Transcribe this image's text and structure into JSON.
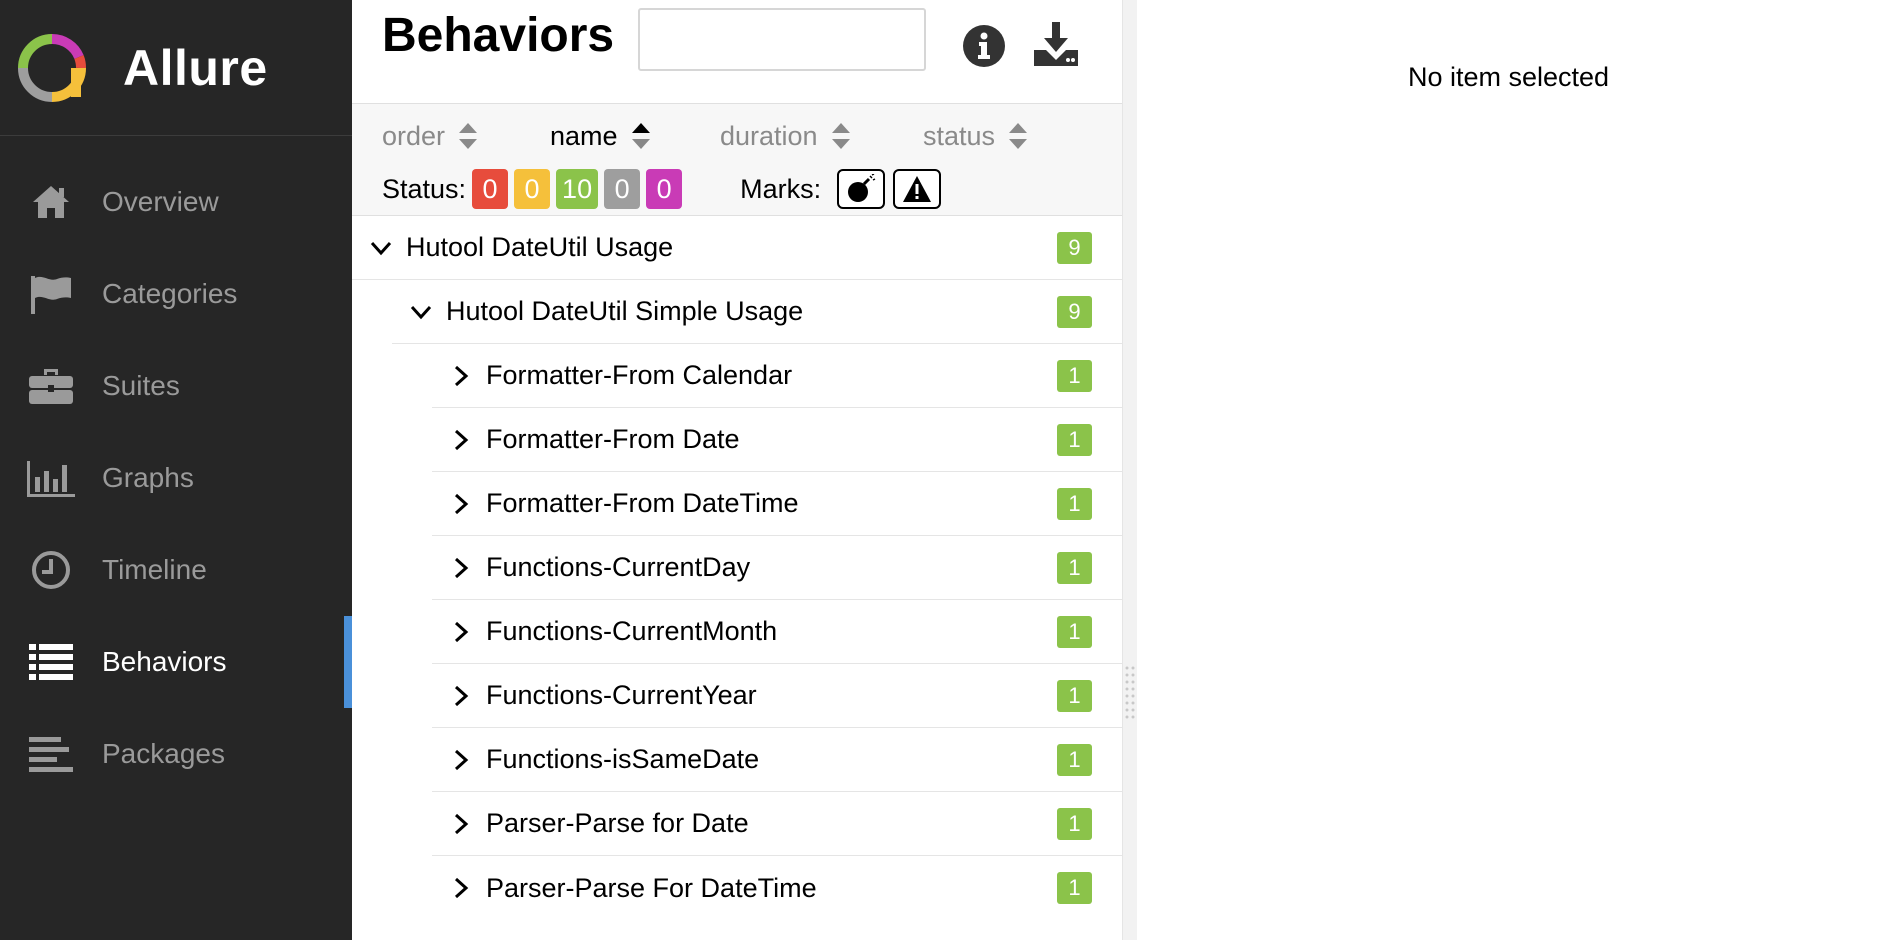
{
  "brand": {
    "name": "Allure"
  },
  "sidebar": {
    "items": [
      {
        "label": "Overview",
        "icon": "home-icon"
      },
      {
        "label": "Categories",
        "icon": "flag-icon"
      },
      {
        "label": "Suites",
        "icon": "briefcase-icon"
      },
      {
        "label": "Graphs",
        "icon": "bar-chart-icon"
      },
      {
        "label": "Timeline",
        "icon": "clock-icon"
      },
      {
        "label": "Behaviors",
        "icon": "list-icon",
        "active": true
      },
      {
        "label": "Packages",
        "icon": "align-left-icon"
      }
    ],
    "accent_color": "#4a90d9"
  },
  "header": {
    "title": "Behaviors",
    "search_value": ""
  },
  "sort": {
    "fields": [
      {
        "label": "order"
      },
      {
        "label": "name",
        "active": true
      },
      {
        "label": "duration"
      },
      {
        "label": "status"
      }
    ]
  },
  "status_filter": {
    "label": "Status:",
    "badges": [
      {
        "status": "failed",
        "count": "0",
        "color": "#e74c3c"
      },
      {
        "status": "broken",
        "count": "0",
        "color": "#f5c03b"
      },
      {
        "status": "passed",
        "count": "10",
        "color": "#8bc34a"
      },
      {
        "status": "skipped",
        "count": "0",
        "color": "#9e9e9e"
      },
      {
        "status": "unknown",
        "count": "0",
        "color": "#c93bb6"
      }
    ]
  },
  "marks": {
    "label": "Marks:",
    "items": [
      {
        "icon": "bomb-icon"
      },
      {
        "icon": "warning-icon"
      }
    ]
  },
  "tree": {
    "rows": [
      {
        "label": "Hutool DateUtil Usage",
        "count": "9",
        "level": 0,
        "expanded": true
      },
      {
        "label": "Hutool DateUtil Simple Usage",
        "count": "9",
        "level": 1,
        "expanded": true
      },
      {
        "label": "Formatter-From Calendar",
        "count": "1",
        "level": 2,
        "expanded": false
      },
      {
        "label": "Formatter-From Date",
        "count": "1",
        "level": 2,
        "expanded": false
      },
      {
        "label": "Formatter-From DateTime",
        "count": "1",
        "level": 2,
        "expanded": false
      },
      {
        "label": "Functions-CurrentDay",
        "count": "1",
        "level": 2,
        "expanded": false
      },
      {
        "label": "Functions-CurrentMonth",
        "count": "1",
        "level": 2,
        "expanded": false
      },
      {
        "label": "Functions-CurrentYear",
        "count": "1",
        "level": 2,
        "expanded": false
      },
      {
        "label": "Functions-isSameDate",
        "count": "1",
        "level": 2,
        "expanded": false
      },
      {
        "label": "Parser-Parse for Date",
        "count": "1",
        "level": 2,
        "expanded": false
      },
      {
        "label": "Parser-Parse For DateTime",
        "count": "1",
        "level": 2,
        "expanded": false
      }
    ]
  },
  "detail": {
    "empty_message": "No item selected"
  }
}
